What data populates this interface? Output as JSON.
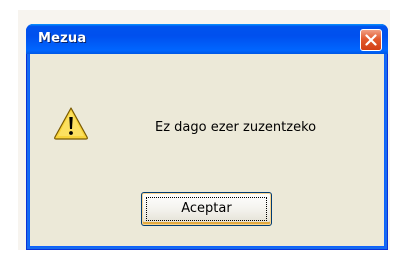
{
  "dialog": {
    "title": "Mezua",
    "message": "Ez dago ezer zuzentzeko",
    "ok_label": "Aceptar",
    "icon": "warning-icon",
    "close_icon": "close-icon"
  },
  "colors": {
    "titlebar": "#0053ee",
    "close_button": "#e2592d",
    "dialog_face": "#ece9d8",
    "warning_fill": "#f9d43a"
  }
}
